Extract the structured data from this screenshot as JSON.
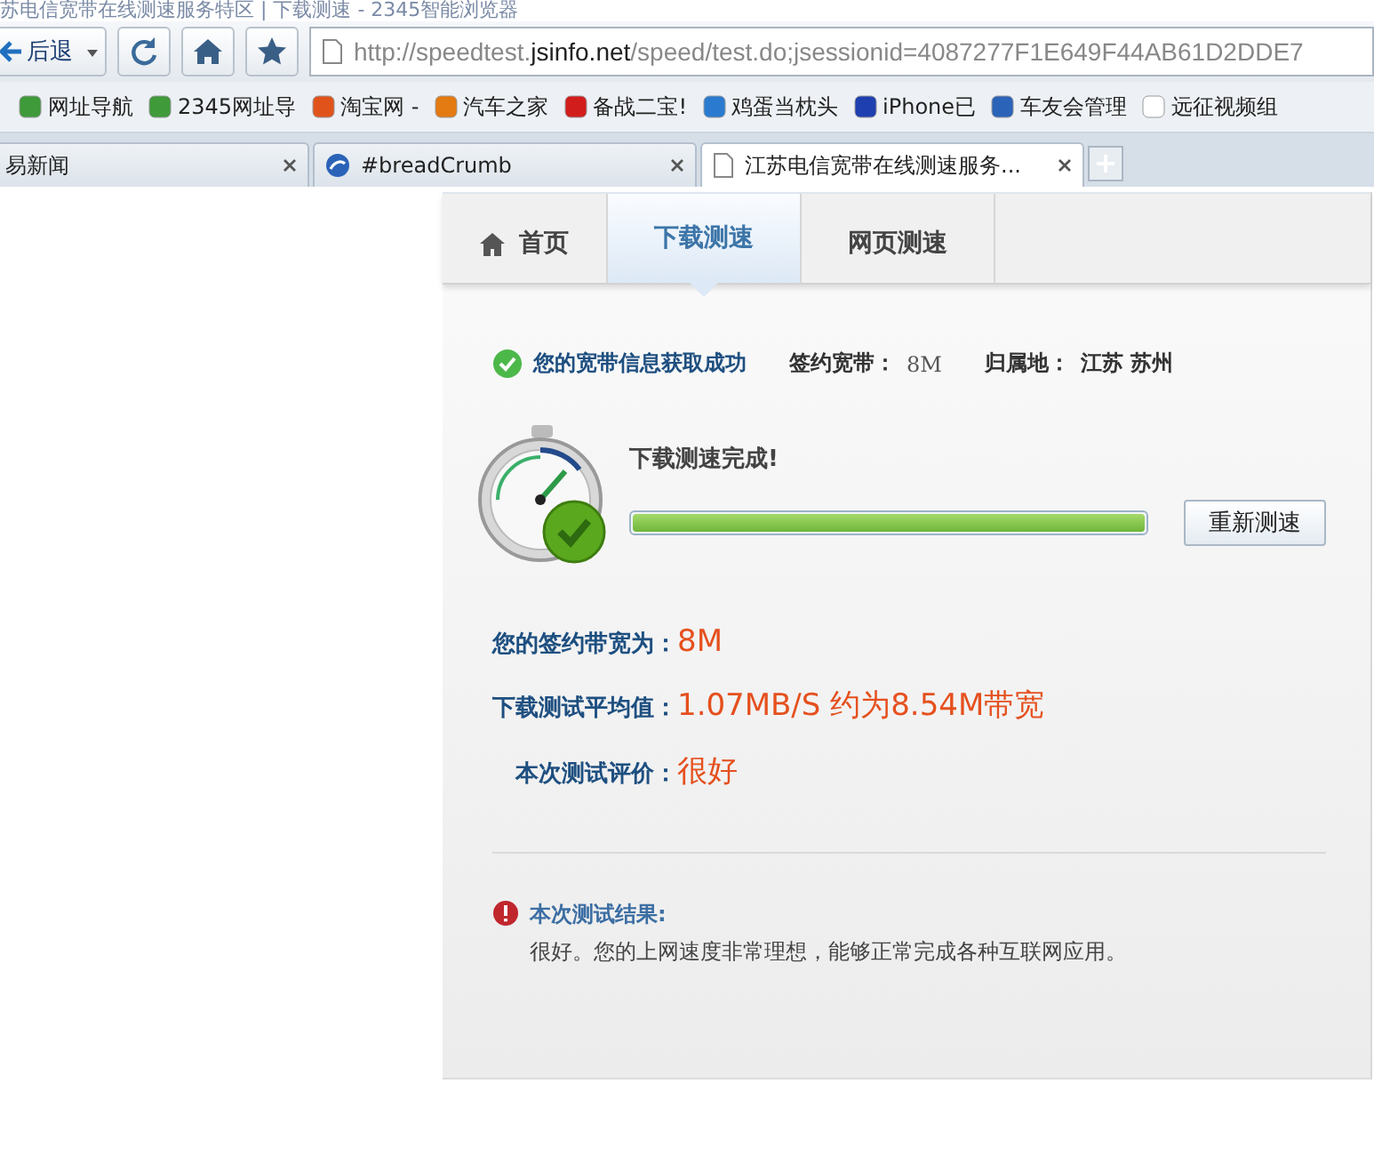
{
  "window": {
    "title": "苏电信宽带在线测速服务特区 | 下载测速 - 2345智能浏览器"
  },
  "toolbar": {
    "back_label": "后退",
    "url_host": "http://speedtest.",
    "url_domain": "jsinfo.net",
    "url_path": "/speed/test.do;jsessionid=4087277F1E649F44AB61D2DDE7"
  },
  "bookmarks": [
    {
      "label": "网址导航"
    },
    {
      "label": "2345网址导"
    },
    {
      "label": "淘宝网 -"
    },
    {
      "label": "汽车之家"
    },
    {
      "label": "备战二宝!"
    },
    {
      "label": "鸡蛋当枕头"
    },
    {
      "label": "iPhone已"
    },
    {
      "label": "车友会管理"
    },
    {
      "label": "远征视频组"
    }
  ],
  "browser_tabs": [
    {
      "label": "易新闻",
      "selected": false
    },
    {
      "label": "#breadCrumb",
      "selected": false
    },
    {
      "label": "江苏电信宽带在线测速服务...",
      "selected": true
    }
  ],
  "site_nav": [
    {
      "label": "首页",
      "kind": "home",
      "selected": false
    },
    {
      "label": "下载测速",
      "kind": "plain",
      "selected": true
    },
    {
      "label": "网页测速",
      "kind": "plain",
      "selected": false
    }
  ],
  "status": {
    "message": "您的宽带信息获取成功",
    "contract_label": "签约宽带：",
    "contract_value": "8M",
    "location_label": "归属地：",
    "location_value": "江苏 苏州"
  },
  "test": {
    "message": "下载测速完成!",
    "level": 1,
    "button": "重新测速"
  },
  "results": [
    {
      "label": "您的签约带宽为：",
      "value": "8M"
    },
    {
      "label": "下载测试平均值：",
      "value": "1.07MB/S 约为8.54M带宽"
    },
    {
      "label": "本次测试评价：",
      "value": "很好"
    }
  ],
  "summary": {
    "title": "本次测试结果:",
    "text": "很好。您的上网速度非常理想，能够正常完成各种互联网应用。"
  }
}
